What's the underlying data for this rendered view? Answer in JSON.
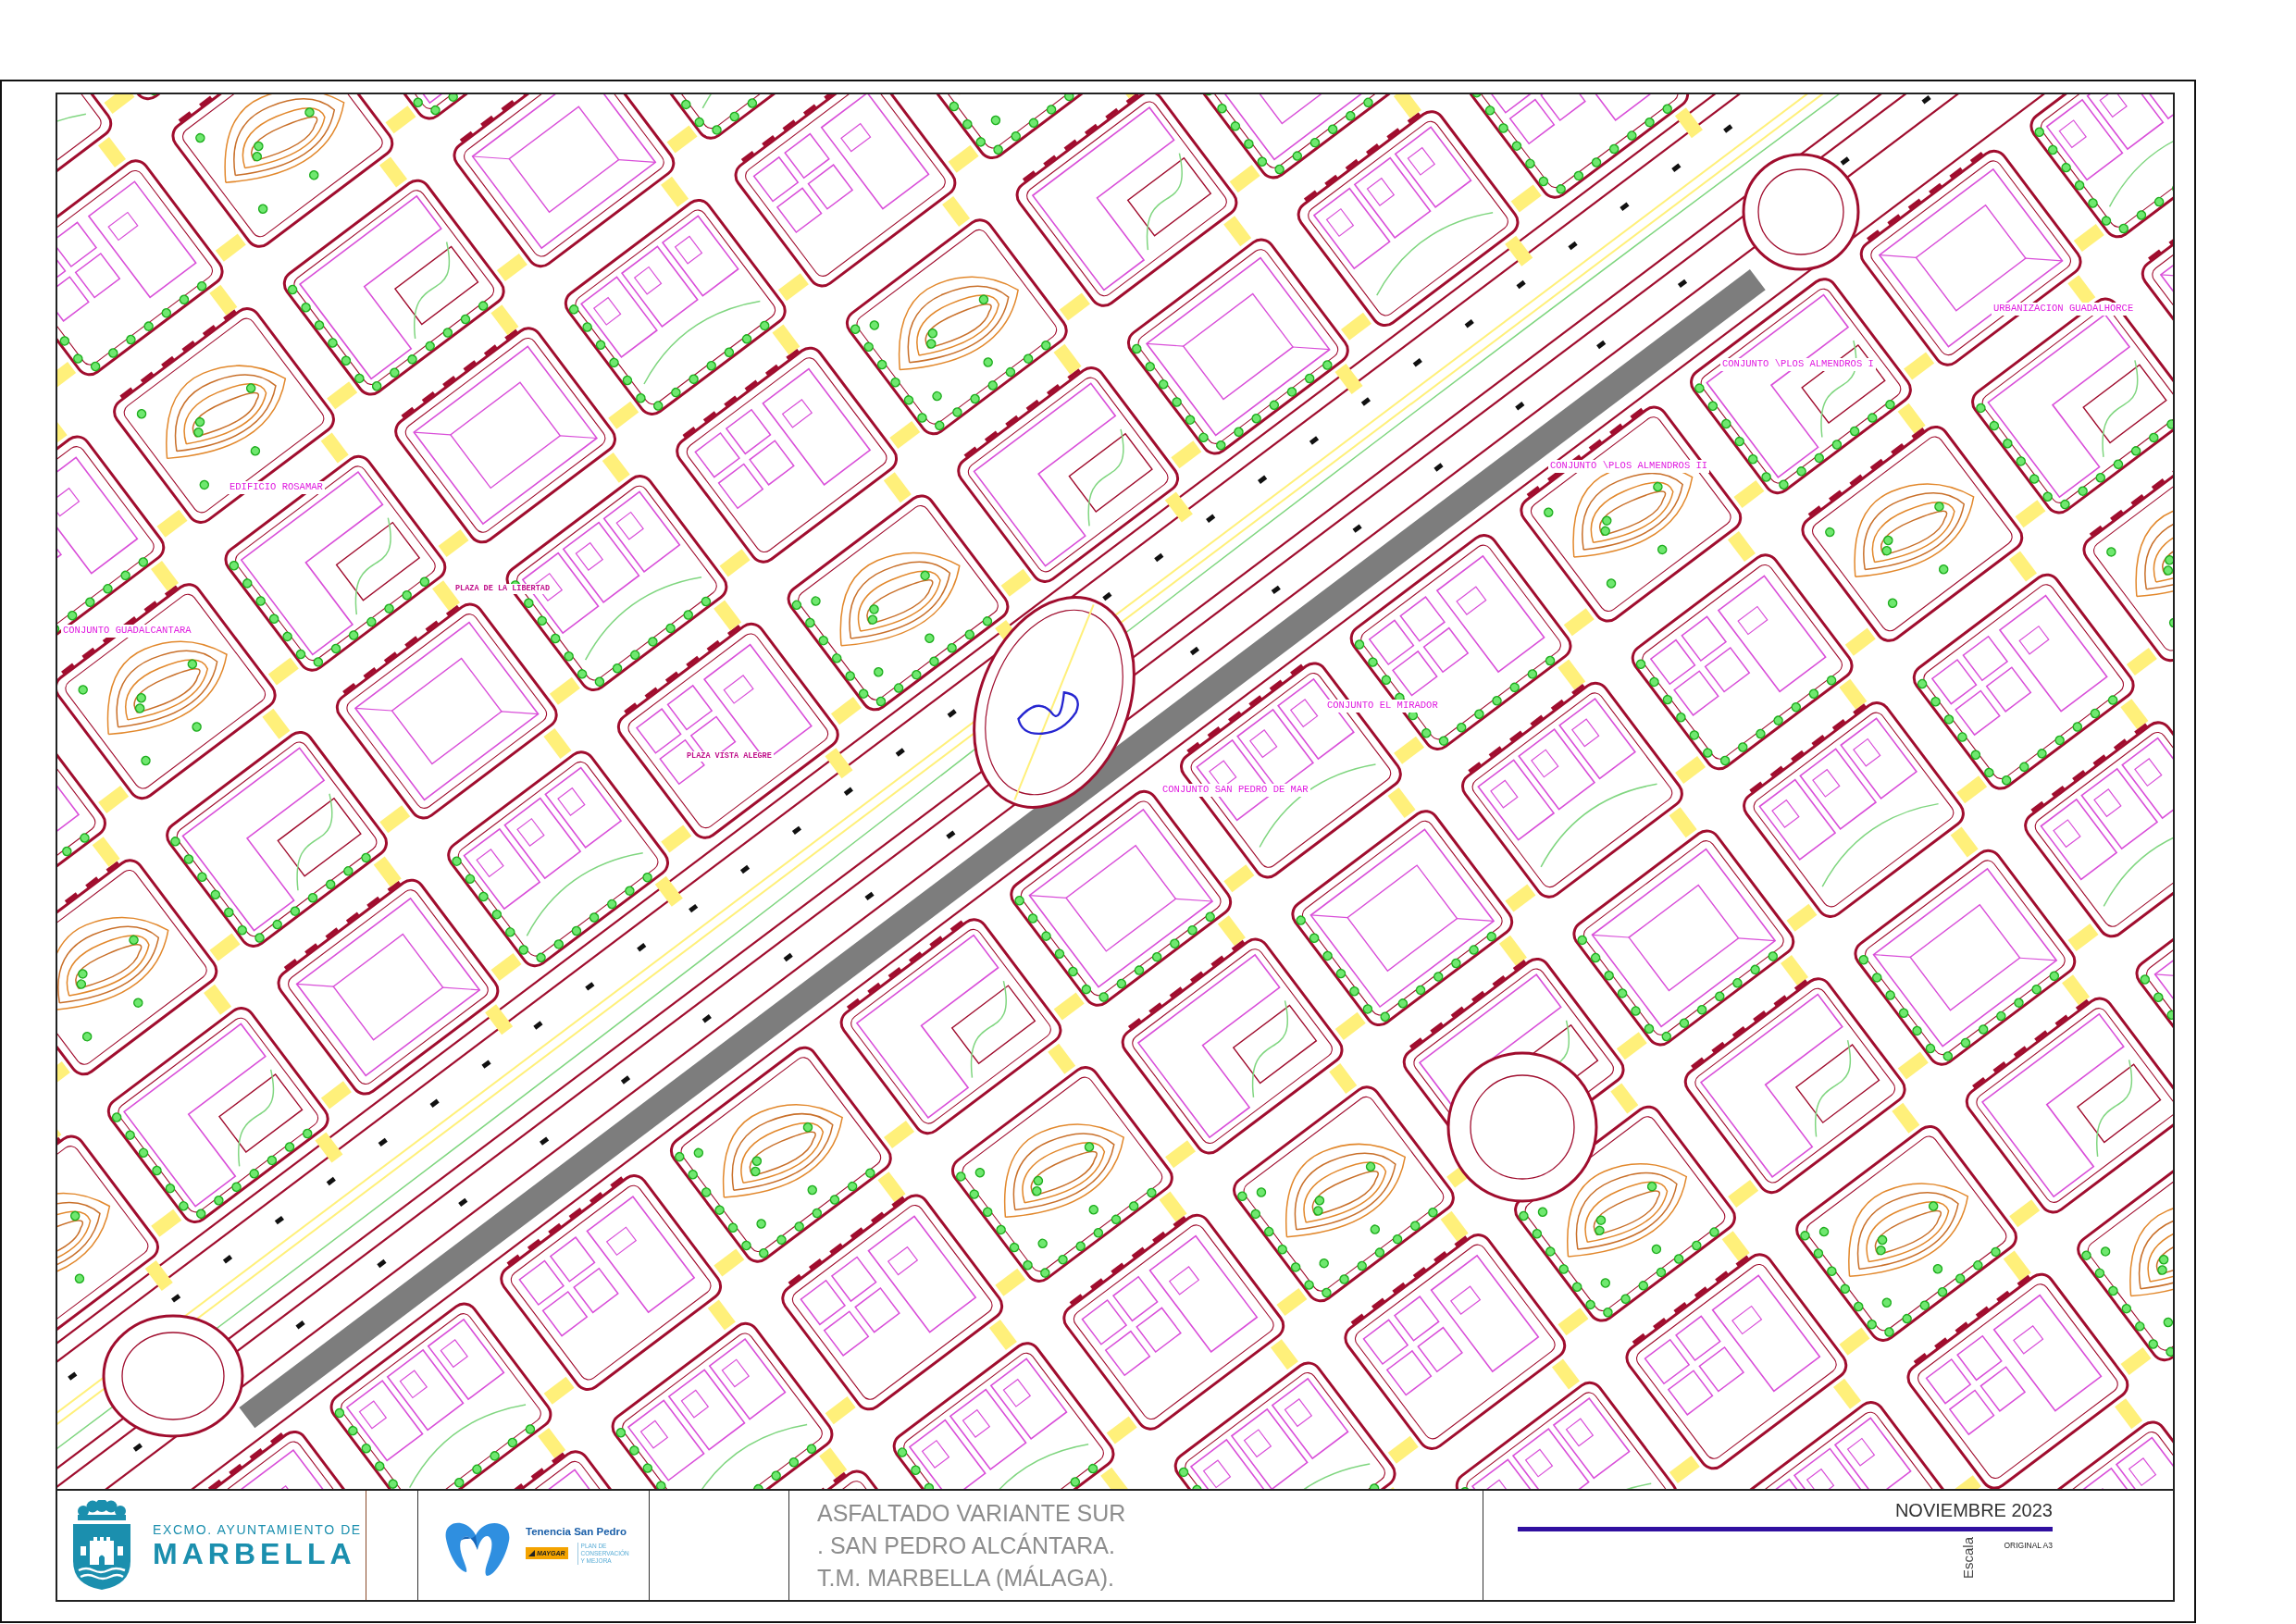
{
  "map": {
    "labels": [
      {
        "text": "EDIFICIO ROSAMAR",
        "kind": "estate"
      },
      {
        "text": "CONJUNTO GUADALCANTARA",
        "kind": "estate"
      },
      {
        "text": "CONJUNTO EL MIRADOR",
        "kind": "estate"
      },
      {
        "text": "CONJUNTO SAN PEDRO DE MAR",
        "kind": "estate"
      },
      {
        "text": "CONJUNTO \\PLOS ALMENDROS I",
        "kind": "estate"
      },
      {
        "text": "CONJUNTO \\PLOS ALMENDROS II",
        "kind": "estate"
      },
      {
        "text": "URBANIZACION GUADALHORCE",
        "kind": "estate"
      },
      {
        "text": "PLAZA DE LA LIBERTAD",
        "kind": "square"
      },
      {
        "text": "PLAZA VISTA ALEGRE",
        "kind": "square"
      }
    ]
  },
  "title_block": {
    "council": {
      "heading": "EXCMO. AYUNTAMIENTO DE",
      "name": "MARBELLA"
    },
    "district": {
      "name": "Tenencia San Pedro",
      "sponsor": "MAYGAR",
      "plan": "PLAN DE CONSERVACIÓN Y MEJORA"
    },
    "project_lines": [
      "ASFALTADO VARIANTE SUR",
      ". SAN PEDRO ALCÁNTARA.",
      "T.M. MARBELLA (MÁLAGA)."
    ],
    "date": "NOVIEMBRE 2023",
    "scale_label": "Escala",
    "paper_size": "ORIGINAL A3"
  }
}
